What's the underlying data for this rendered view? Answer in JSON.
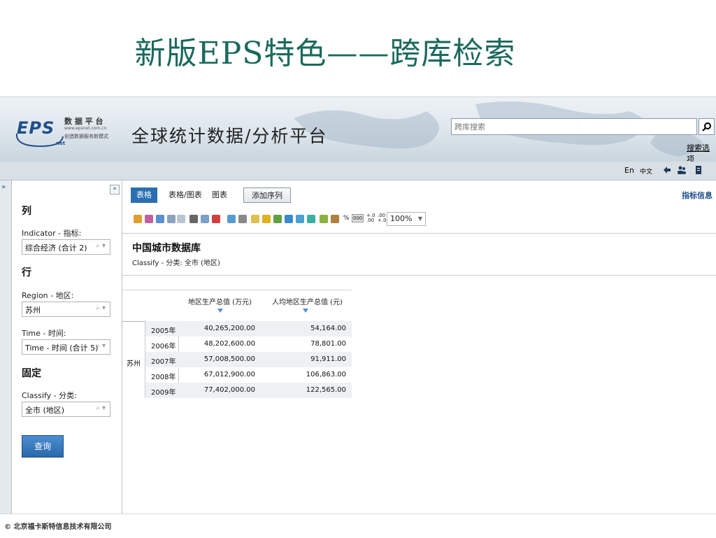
{
  "slide": {
    "title": "新版EPS特色——跨库检索"
  },
  "header": {
    "logo_text": "EPS",
    "logo_net": "net",
    "logo_cn": "数 据 平 台",
    "logo_url": "www.epsnet.com.cn",
    "logo_slogan": "创造数据服务新模式",
    "platform_title": "全球统计数据/分析平台",
    "search_placeholder": "跨库搜索",
    "search_options": "搜索选项"
  },
  "top_toolbar": {
    "lang_en": "En",
    "lang_cn": "中文"
  },
  "sidebar": {
    "col_head": "列",
    "indicator_label": "Indicator - 指标:",
    "indicator_value": "综合经济 (合计 2)",
    "row_head": "行",
    "region_label": "Region - 地区:",
    "region_value": "苏州",
    "time_label": "Time - 时间:",
    "time_value": "Time - 时间 (合计 5)",
    "fixed_head": "固定",
    "classify_label": "Classify - 分类:",
    "classify_value": "全市 (地区)",
    "query_button": "查询"
  },
  "main": {
    "tabs": [
      "表格",
      "表格/图表",
      "图表"
    ],
    "add_series": "添加序列",
    "indicator_info": "指标信息",
    "zoom": "100%",
    "db_title": "中国城市数据库",
    "classify_text": "Classify - 分类: 全市 (地区)"
  },
  "table": {
    "columns": [
      "地区生产总值 (万元)",
      "人均地区生产总值 (元)"
    ],
    "region": "苏州",
    "rows": [
      {
        "year": "2005年",
        "gdp": "40,265,200.00",
        "per_capita": "54,164.00"
      },
      {
        "year": "2006年",
        "gdp": "48,202,600.00",
        "per_capita": "78,801.00"
      },
      {
        "year": "2007年",
        "gdp": "57,008,500.00",
        "per_capita": "91,911.00"
      },
      {
        "year": "2008年",
        "gdp": "67,012,900.00",
        "per_capita": "106,863.00"
      },
      {
        "year": "2009年",
        "gdp": "77,402,000.00",
        "per_capita": "122,565.00"
      }
    ]
  },
  "footer": {
    "copyright": "© 北京福卡斯特信息技术有限公司"
  },
  "colors": {
    "title": "#1a6a5c",
    "accent": "#2a6fb0",
    "brand": "#1e4f8a"
  }
}
